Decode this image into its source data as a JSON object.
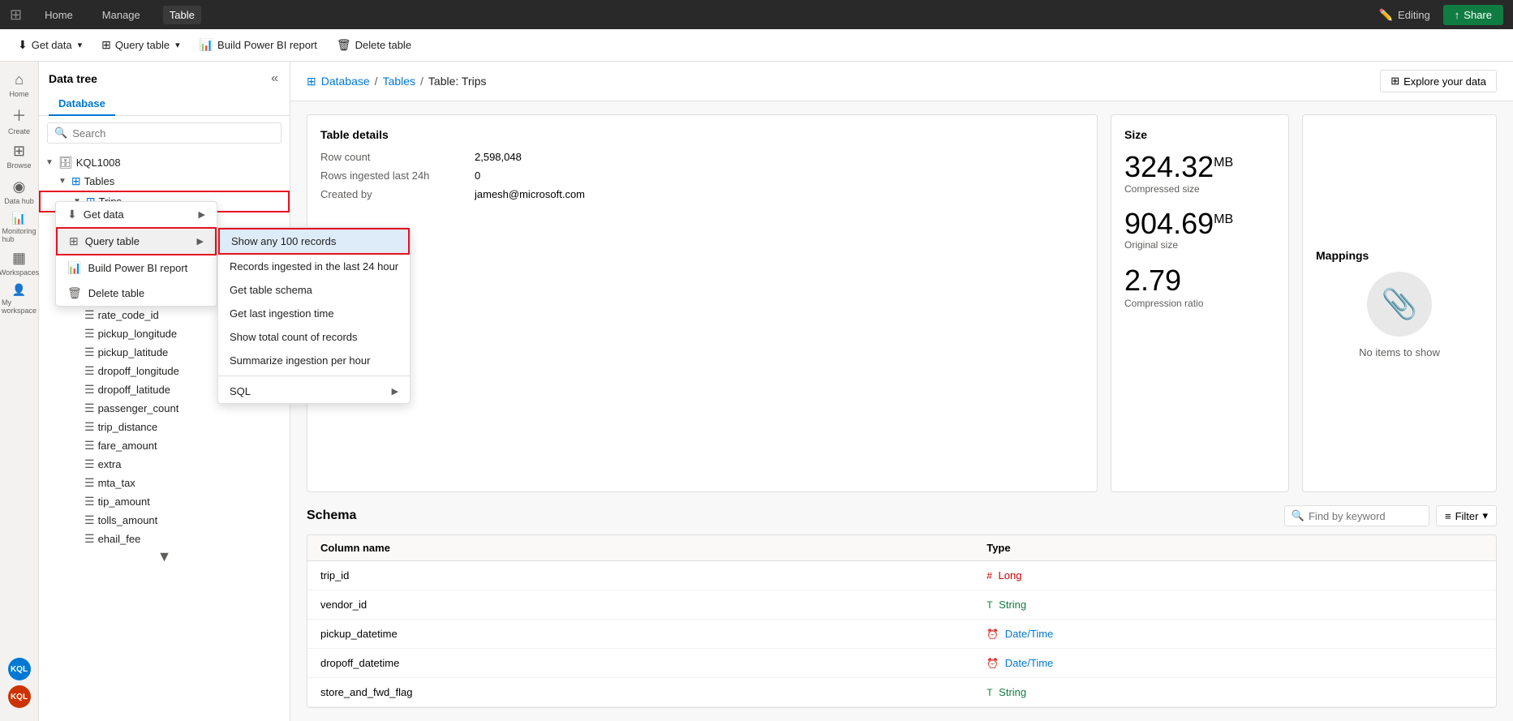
{
  "topNav": {
    "items": [
      "Home",
      "Manage",
      "Table"
    ],
    "activeItem": "Table",
    "editing": "Editing",
    "shareLabel": "Share",
    "editingIcon": "✏️"
  },
  "toolbar": {
    "getDataLabel": "Get data",
    "queryTableLabel": "Query table",
    "buildReportLabel": "Build Power BI report",
    "deleteTableLabel": "Delete table"
  },
  "leftNav": {
    "items": [
      {
        "name": "home",
        "symbol": "⌂",
        "label": "Home"
      },
      {
        "name": "create",
        "symbol": "+",
        "label": "Create"
      },
      {
        "name": "browse",
        "symbol": "⊞",
        "label": "Browse"
      },
      {
        "name": "datahub",
        "symbol": "◉",
        "label": "Data hub"
      },
      {
        "name": "monitoring",
        "symbol": "📊",
        "label": "Monitoring hub"
      },
      {
        "name": "workspaces",
        "symbol": "▦",
        "label": "Workspaces"
      },
      {
        "name": "myworkspace",
        "symbol": "👤",
        "label": "My workspace"
      }
    ],
    "bottomItems": [
      {
        "name": "kql1",
        "label": "KQL1008",
        "type": "kql-badge"
      },
      {
        "name": "kql2",
        "label": "KQL1008",
        "type": "kql-badge2"
      }
    ]
  },
  "dataTree": {
    "title": "Data tree",
    "tabs": [
      "Database"
    ],
    "activeTab": "Database",
    "searchPlaceholder": "Search",
    "databases": [
      {
        "name": "KQL1008",
        "expanded": true,
        "children": [
          {
            "name": "Tables",
            "expanded": true,
            "children": [
              {
                "name": "Trips",
                "selected": true,
                "highlighted": true,
                "columns": [
                  "trip_id",
                  "vendor_id",
                  "pickup_datetime",
                  "dropoff_datetime",
                  "store_and_fwd_flag",
                  "rate_code_id",
                  "pickup_longitude",
                  "pickup_latitude",
                  "dropoff_longitude",
                  "dropoff_latitude",
                  "passenger_count",
                  "trip_distance",
                  "fare_amount",
                  "extra",
                  "mta_tax",
                  "tip_amount",
                  "tolls_amount",
                  "ehail_fee"
                ]
              }
            ]
          }
        ]
      }
    ]
  },
  "breadcrumb": {
    "database": "Database",
    "tables": "Tables",
    "current": "Table: Trips",
    "tableIcon": "⊞",
    "exploreLabel": "Explore your data",
    "exploreIcon": "⊞"
  },
  "tableDetails": {
    "cardTitle": "Table details",
    "rowCountLabel": "Row count",
    "rowCountValue": "2,598,048",
    "rowsIngestedLabel": "Rows ingested last 24h",
    "rowsIngestedValue": "0",
    "createdByLabel": "Created by",
    "createdByValue": "jamesh@microsoft.com"
  },
  "sizeCard": {
    "title": "Size",
    "compressedSize": "324.32",
    "compressedUnit": "MB",
    "compressedLabel": "Compressed size",
    "originalSize": "904.69",
    "originalUnit": "MB",
    "originalLabel": "Original size",
    "compressionRatio": "2.79",
    "compressionLabel": "Compression ratio"
  },
  "mappingsCard": {
    "title": "Mappings",
    "noItemsText": "No items to show",
    "clipIcon": "📎"
  },
  "schema": {
    "title": "Schema",
    "findByKeywordPlaceholder": "Find by keyword",
    "filterLabel": "Filter",
    "columns": [
      {
        "name": "trip_id",
        "type": "Long",
        "typeClass": "long",
        "typeIcon": "#"
      },
      {
        "name": "vendor_id",
        "type": "String",
        "typeClass": "string",
        "typeIcon": "T"
      },
      {
        "name": "pickup_datetime",
        "type": "Date/Time",
        "typeClass": "datetime",
        "typeIcon": "⏰"
      },
      {
        "name": "dropoff_datetime",
        "type": "Date/Time",
        "typeClass": "datetime",
        "typeIcon": "⏰"
      },
      {
        "name": "store_and_fwd_flag",
        "type": "String",
        "typeClass": "string",
        "typeIcon": "T"
      }
    ],
    "columnHeader": "Column name",
    "typeHeader": "Type"
  },
  "contextMenu": {
    "items": [
      {
        "label": "Get data",
        "icon": "↓",
        "hasSubmenu": true
      },
      {
        "label": "Query table",
        "icon": "⊞",
        "hasSubmenu": true,
        "highlighted": true
      },
      {
        "label": "Build Power BI report",
        "icon": "📊",
        "hasSubmenu": false
      },
      {
        "label": "Delete table",
        "icon": "🗑",
        "hasSubmenu": false
      }
    ]
  },
  "submenu": {
    "items": [
      {
        "label": "Show any 100 records",
        "highlighted": true
      },
      {
        "label": "Records ingested in the last 24 hour"
      },
      {
        "label": "Get table schema"
      },
      {
        "label": "Get last ingestion time"
      },
      {
        "label": "Show total count of records"
      },
      {
        "label": "Summarize ingestion per hour"
      },
      {
        "label": "SQL",
        "hasSubmenu": true
      }
    ]
  }
}
